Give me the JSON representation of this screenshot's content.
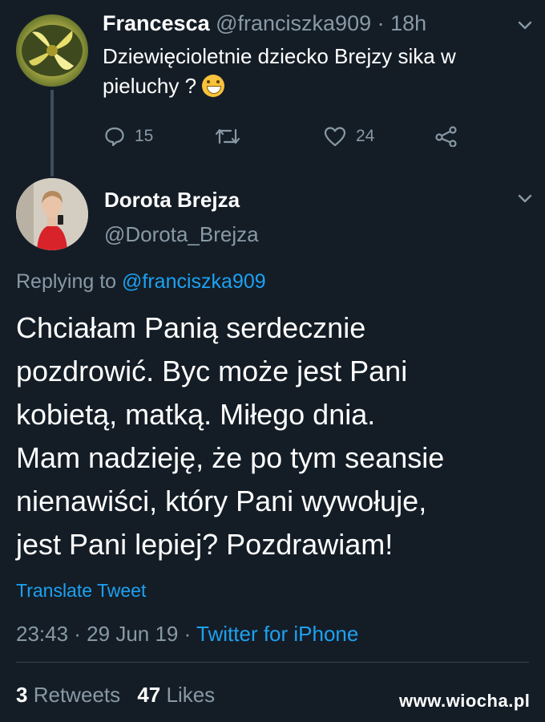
{
  "parent_tweet": {
    "display_name": "Francesca",
    "handle": "@franciszka909",
    "separator": "·",
    "time": "18h",
    "text": "Dziewięcioletnie dziecko Brejzy sika w pieluchy ?",
    "emoji_icon": "grinning-face-icon",
    "reply_count": "15",
    "like_count": "24"
  },
  "main_tweet": {
    "display_name": "Dorota Brejza",
    "handle": "@Dorota_Brejza",
    "replying_prefix": "Replying to",
    "replying_handle": "@franciszka909",
    "lines": [
      "Chciałam Panią serdecznie",
      "pozdrowić. Byc może jest Pani",
      "kobietą, matką. Miłego dnia.",
      "Mam nadzieję, że po tym seansie",
      "nienawiści, który Pani wywołuje,",
      "jest Pani lepiej? Pozdrawiam!"
    ],
    "translate_label": "Translate Tweet",
    "timestamp": "23:43 · 29 Jun 19 ·",
    "source": "Twitter for iPhone",
    "retweet_count": "3",
    "retweets_label": "Retweets",
    "like_count": "47",
    "likes_label": "Likes"
  },
  "watermark": "www.wiocha.pl",
  "colors": {
    "background": "#141d26",
    "muted": "#8899a6",
    "link": "#1da1f2"
  }
}
